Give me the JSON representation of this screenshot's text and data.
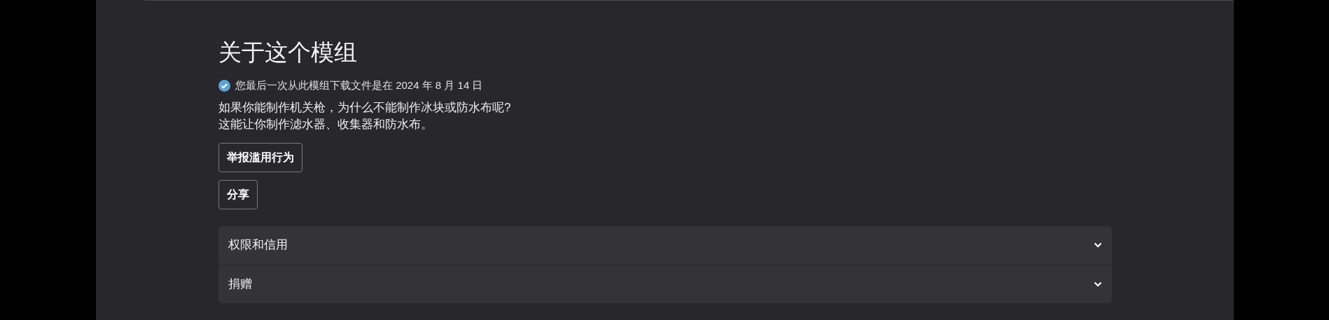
{
  "section": {
    "title": "关于这个模组",
    "download_notice": {
      "downloaded": true,
      "text": "您最后一次从此模组下载文件是在 2024 年 8 月 14 日"
    },
    "description": [
      "如果你能制作机关枪，为什么不能制作冰块或防水布呢?",
      "这能让你制作滤水器、收集器和防水布。"
    ],
    "buttons": [
      "举报滥用行为",
      "分享"
    ],
    "accordion": [
      {
        "label": "权限和信用",
        "expanded": false
      },
      {
        "label": "捐赠",
        "expanded": false
      }
    ]
  }
}
